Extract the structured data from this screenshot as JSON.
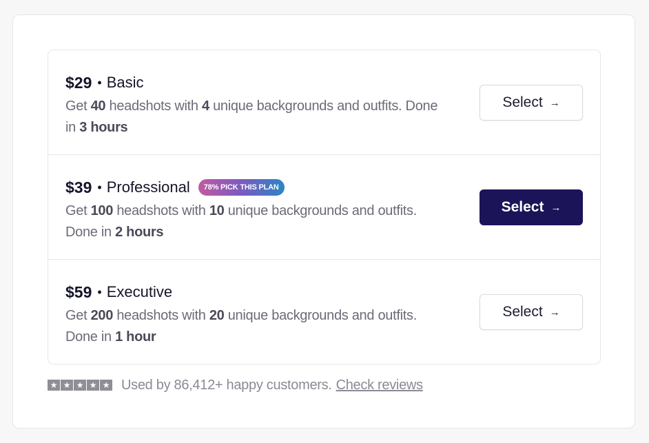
{
  "plans": [
    {
      "price": "$29",
      "separator": "•",
      "name": "Basic",
      "desc": {
        "p1": "Get ",
        "count": "40",
        "p2": " headshots with ",
        "backgrounds": "4",
        "p3": " unique backgrounds and outfits. Done in ",
        "time": "3 hours"
      },
      "button": "Select",
      "button_icon": "→"
    },
    {
      "price": "$39",
      "separator": "•",
      "name": "Professional",
      "badge": "78% PICK THIS PLAN",
      "desc": {
        "p1": "Get ",
        "count": "100",
        "p2": " headshots with ",
        "backgrounds": "10",
        "p3": " unique backgrounds and outfits. Done in ",
        "time": "2 hours"
      },
      "button": "Select",
      "button_icon": "→"
    },
    {
      "price": "$59",
      "separator": "•",
      "name": "Executive",
      "desc": {
        "p1": "Get ",
        "count": "200",
        "p2": " headshots with ",
        "backgrounds": "20",
        "p3": " unique backgrounds and outfits. Done in ",
        "time": "1 hour"
      },
      "button": "Select",
      "button_icon": "→"
    }
  ],
  "footer": {
    "rating": 5,
    "star_glyph": "★",
    "text": "Used by 86,412+ happy customers.",
    "link": "Check reviews"
  },
  "colors": {
    "primary_button": "#1c1458",
    "badge_gradient_start": "#c25aa3",
    "badge_gradient_end": "#2b86c5"
  }
}
